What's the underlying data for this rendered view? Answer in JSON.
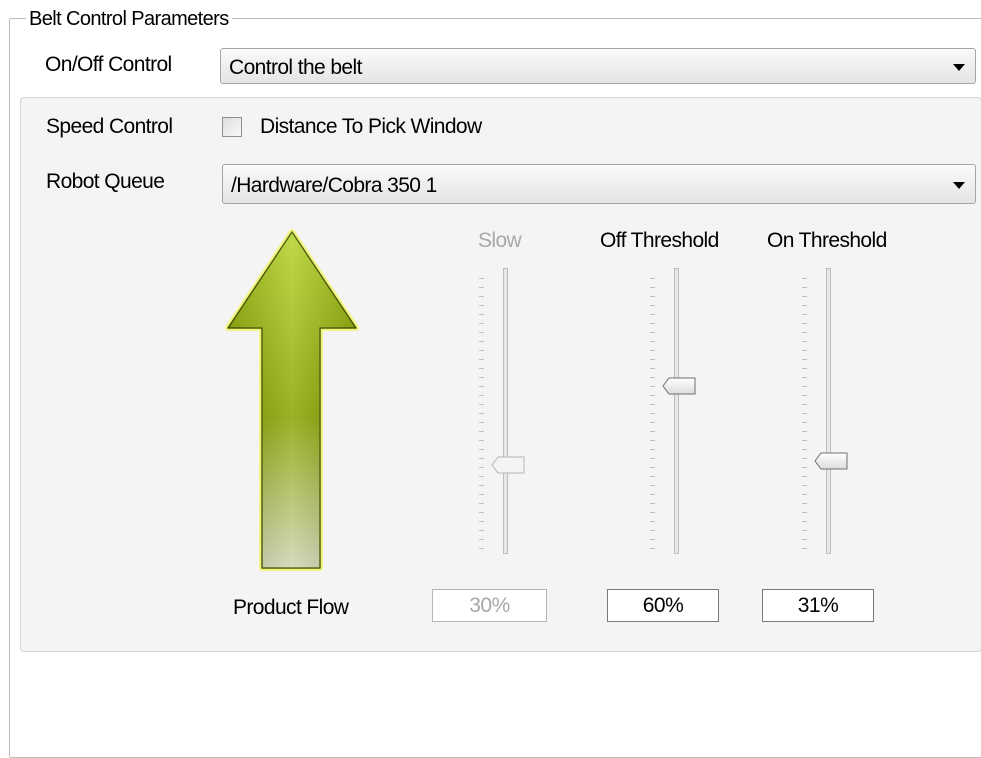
{
  "group": {
    "title": "Belt Control Parameters"
  },
  "onoff": {
    "label": "On/Off Control",
    "value": "Control the belt"
  },
  "speed": {
    "label": "Speed Control",
    "checkbox_label": "Distance To Pick Window",
    "checked": false
  },
  "robot_queue": {
    "label": "Robot Queue",
    "value": "/Hardware/Cobra 350 1"
  },
  "flow": {
    "label": "Product Flow",
    "arrow_color": "#9ab800"
  },
  "sliders": [
    {
      "label": "Slow",
      "value": "30%",
      "level": 0.3,
      "enabled": false
    },
    {
      "label": "Off Threshold",
      "value": "60%",
      "level": 0.6,
      "enabled": true
    },
    {
      "label": "On Threshold",
      "value": "31%",
      "level": 0.31,
      "enabled": true
    }
  ]
}
